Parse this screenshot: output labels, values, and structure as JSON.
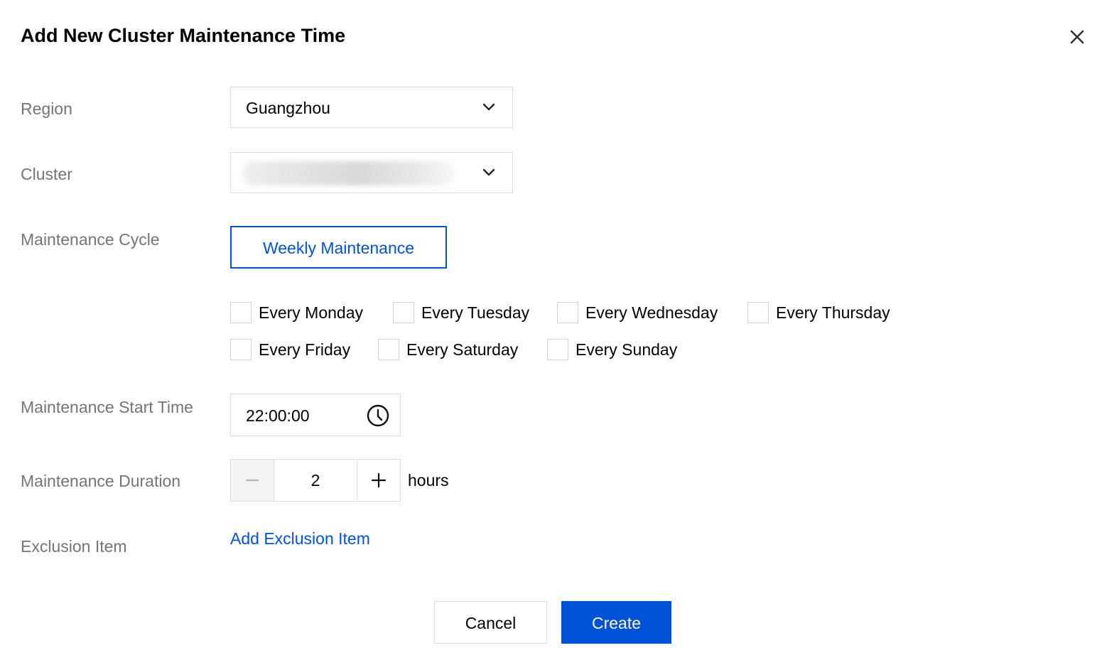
{
  "dialog": {
    "title": "Add New Cluster Maintenance Time",
    "close_icon": "close-icon"
  },
  "form": {
    "region": {
      "label": "Region",
      "value": "Guangzhou",
      "icon": "chevron-down-icon"
    },
    "cluster": {
      "label": "Cluster",
      "value_redacted": true,
      "icon": "chevron-down-icon"
    },
    "cycle": {
      "label": "Maintenance Cycle",
      "button_label": "Weekly Maintenance",
      "days": [
        {
          "label": "Every Monday",
          "checked": false
        },
        {
          "label": "Every Tuesday",
          "checked": false
        },
        {
          "label": "Every Wednesday",
          "checked": false
        },
        {
          "label": "Every Thursday",
          "checked": false
        },
        {
          "label": "Every Friday",
          "checked": false
        },
        {
          "label": "Every Saturday",
          "checked": false
        },
        {
          "label": "Every Sunday",
          "checked": false
        }
      ]
    },
    "start_time": {
      "label": "Maintenance Start Time",
      "value": "22:00:00",
      "icon": "clock-icon"
    },
    "duration": {
      "label": "Maintenance Duration",
      "value": "2",
      "unit": "hours",
      "decrement_icon": "minus-icon",
      "increment_icon": "plus-icon",
      "decrement_disabled": true
    },
    "exclusion": {
      "label": "Exclusion Item",
      "link_label": "Add Exclusion Item"
    }
  },
  "footer": {
    "cancel_label": "Cancel",
    "create_label": "Create"
  },
  "colors": {
    "accent": "#0052d9",
    "label_gray": "#757575",
    "border": "#dcdcdc",
    "disabled_bg": "#f3f3f3"
  }
}
